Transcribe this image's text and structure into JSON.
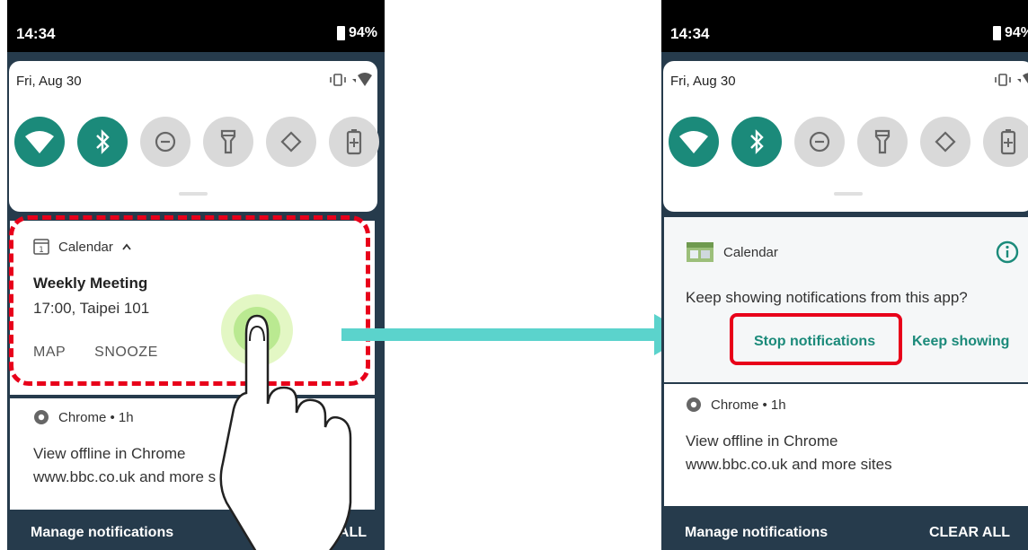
{
  "left": {
    "status": {
      "time": "14:34",
      "battery": "94%"
    },
    "qs": {
      "date": "Fri, Aug 30"
    },
    "calendar_notification": {
      "app": "Calendar",
      "title": "Weekly Meeting",
      "detail": "17:00, Taipei 101",
      "action_map": "MAP",
      "action_snooze": "SNOOZE"
    },
    "chrome_notification": {
      "app": "Chrome • 1h",
      "title": "View offline in Chrome",
      "detail": "www.bbc.co.uk and more s"
    },
    "footer": {
      "manage": "Manage notifications",
      "clear": "CLEAR ALL"
    }
  },
  "right": {
    "status": {
      "time": "14:34",
      "battery": "94%"
    },
    "qs": {
      "date": "Fri, Aug 30"
    },
    "calendar_prompt": {
      "app": "Calendar",
      "question": "Keep showing notifications from this app?",
      "stop": "Stop notifications",
      "keep": "Keep showing"
    },
    "chrome_notification": {
      "app": "Chrome • 1h",
      "title": "View offline in Chrome",
      "detail": "www.bbc.co.uk and more sites"
    },
    "footer": {
      "manage": "Manage notifications",
      "clear": "CLEAR ALL"
    }
  },
  "colors": {
    "accent": "#1b8a7a",
    "highlight": "#e8001a",
    "arrow": "#5bd3cc",
    "shade": "#263b4c"
  },
  "icons": [
    "wifi-icon",
    "bluetooth-icon",
    "dnd-icon",
    "flashlight-icon",
    "auto-rotate-icon",
    "battery-saver-icon",
    "vibrate-icon",
    "signal-icon",
    "calendar-icon",
    "chevron-up-icon",
    "chrome-icon",
    "info-icon",
    "tap-hand-icon"
  ]
}
